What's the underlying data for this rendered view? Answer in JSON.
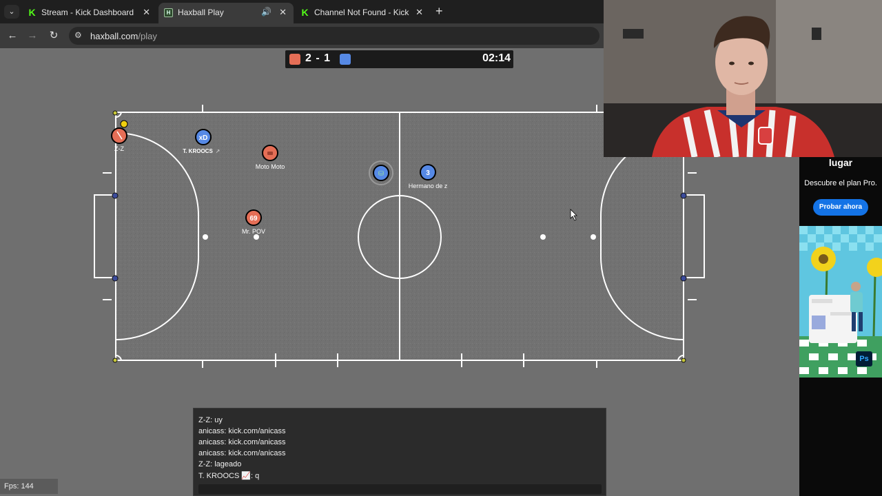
{
  "browser": {
    "tabs": [
      {
        "title": "Stream - Kick Dashboard",
        "favicon": "kick-icon",
        "active": false
      },
      {
        "title": "Haxball Play",
        "favicon": "haxball-icon",
        "active": true,
        "audio": true
      },
      {
        "title": "Channel Not Found - Kick Strea",
        "favicon": "kick-icon",
        "active": false
      }
    ],
    "new_tab": "+",
    "url_host": "haxball.com",
    "url_path": "/play"
  },
  "game": {
    "score": "2 - 1",
    "time": "02:14",
    "colors": {
      "red": "#e56e56",
      "blue": "#5689e5",
      "pitch": "#6f6f6f",
      "lines": "#ffffff"
    },
    "players": [
      {
        "name": "Z-Z",
        "team": "red",
        "avatar": ""
      },
      {
        "name": "T. KROOCS",
        "team": "blue",
        "avatar": "xD"
      },
      {
        "name": "Moto Moto",
        "team": "red",
        "avatar": ""
      },
      {
        "name": "Mr. POV",
        "team": "red",
        "avatar": "69"
      },
      {
        "name": "Hermano de z",
        "team": "blue",
        "avatar": "3"
      }
    ],
    "chat": [
      "Z-Z: uy",
      "anicass: kick.com/anicass",
      "anicass: kick.com/anicass",
      "anicass: kick.com/anicass",
      "Z-Z: lageado",
      "T. KROOCS 📈: q"
    ],
    "fps": "Fps: 144"
  },
  "ad": {
    "headline": "lugar",
    "description": "Descubre el plan Pro.",
    "cta": "Probar ahora",
    "badge": "Ps"
  }
}
